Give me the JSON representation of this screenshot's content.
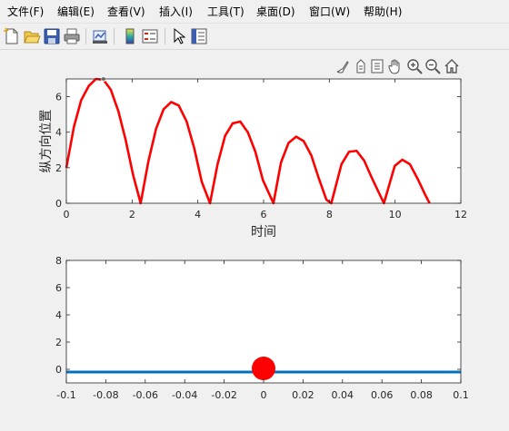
{
  "menu": [
    {
      "label": "文件(F)"
    },
    {
      "label": "编辑(E)"
    },
    {
      "label": "查看(V)"
    },
    {
      "label": "插入(I)"
    },
    {
      "label": "工具(T)"
    },
    {
      "label": "桌面(D)"
    },
    {
      "label": "窗口(W)"
    },
    {
      "label": "帮助(H)"
    }
  ],
  "toolbar_icons": [
    "new-figure-icon",
    "open-file-icon",
    "save-icon",
    "print-icon",
    "link-plot-icon",
    "insert-colorbar-icon",
    "insert-legend-icon",
    "edit-plot-icon",
    "property-inspector-icon"
  ],
  "axes_toolbar_icons": [
    "brush-icon",
    "data-tips-icon",
    "export-icon",
    "pan-icon",
    "zoom-in-icon",
    "zoom-out-icon",
    "home-icon"
  ],
  "chart_data": [
    {
      "type": "line",
      "xlabel": "时间",
      "ylabel": "纵方向位置",
      "xlim": [
        0,
        12
      ],
      "ylim": [
        0,
        7
      ],
      "xticks": [
        "0",
        "2",
        "4",
        "6",
        "8",
        "10",
        "12"
      ],
      "yticks": [
        "0",
        "2",
        "4",
        "6"
      ],
      "grid": false,
      "series": [
        {
          "color": "#ff0000",
          "x": [
            0,
            0.23,
            0.45,
            0.68,
            0.9,
            1.13,
            1.35,
            1.58,
            1.8,
            2.03,
            2.26,
            2.5,
            2.73,
            2.96,
            3.19,
            3.42,
            3.66,
            3.89,
            4.12,
            4.37,
            4.6,
            4.83,
            5.06,
            5.29,
            5.52,
            5.75,
            5.98,
            6.3,
            6.53,
            6.76,
            6.99,
            7.22,
            7.45,
            7.68,
            7.91,
            8.06,
            8.37,
            8.6,
            8.83,
            9.06,
            9.3,
            9.66,
            9.99,
            10.22,
            10.45,
            10.68,
            10.91,
            11.05
          ],
          "y": [
            2.0,
            4.3,
            5.8,
            6.6,
            7.0,
            6.95,
            6.4,
            5.2,
            3.6,
            1.6,
            0.0,
            2.4,
            4.2,
            5.3,
            5.7,
            5.5,
            4.6,
            3.1,
            1.2,
            0.0,
            2.2,
            3.8,
            4.5,
            4.6,
            4.0,
            2.9,
            1.3,
            0.0,
            2.3,
            3.4,
            3.75,
            3.5,
            2.7,
            1.4,
            0.2,
            0.0,
            2.2,
            2.9,
            2.95,
            2.4,
            1.4,
            0.0,
            2.1,
            2.45,
            2.2,
            1.4,
            0.5,
            0.0
          ]
        }
      ],
      "marker": {
        "x": 1.13,
        "y": 7.0,
        "color": "#8a8a8a"
      }
    },
    {
      "type": "scatter",
      "xlim": [
        -0.1,
        0.1
      ],
      "ylim": [
        -1,
        8
      ],
      "xticks": [
        "-0.1",
        "-0.08",
        "-0.06",
        "-0.04",
        "-0.02",
        "0",
        "0.02",
        "0.04",
        "0.06",
        "0.08",
        "0.1"
      ],
      "yticks": [
        "0",
        "2",
        "4",
        "6",
        "8"
      ],
      "grid": false,
      "ground_line": {
        "y": -0.2,
        "color": "#0072bd"
      },
      "ball": {
        "x": 0,
        "y": 0,
        "color": "#ff0000"
      }
    }
  ]
}
